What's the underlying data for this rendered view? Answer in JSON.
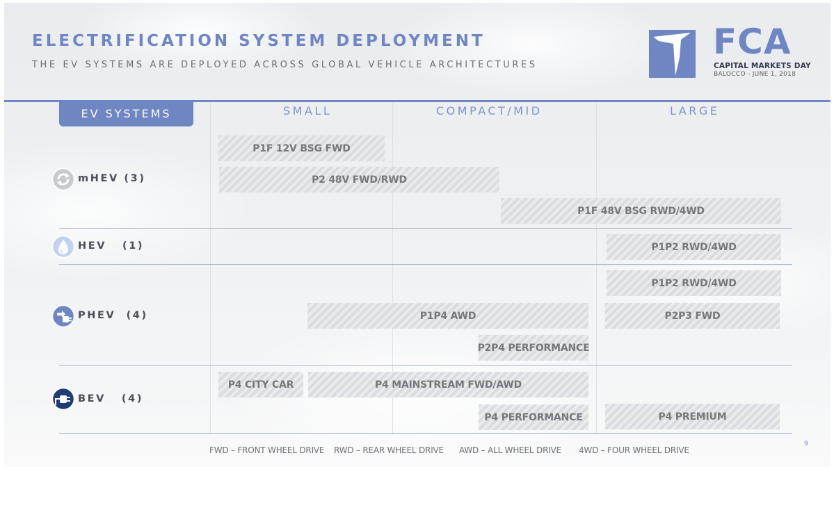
{
  "header": {
    "title": "ELECTRIFICATION SYSTEM DEPLOYMENT",
    "subtitle": "THE EV SYSTEMS ARE DEPLOYED ACROSS GLOBAL VEHICLE ARCHITECTURES"
  },
  "logo": {
    "wordmark": "FCA",
    "event": "CAPITAL MARKETS DAY",
    "location_date": "BALOCCO - JUNE 1, 2018"
  },
  "table": {
    "row_header": "EV SYSTEMS",
    "columns": [
      "SMALL",
      "COMPACT/MID",
      "LARGE"
    ],
    "rows": [
      {
        "label": "mHEV (3)",
        "icon": "recycle-icon"
      },
      {
        "label": "HEV   (1)",
        "icon": "drop-icon"
      },
      {
        "label": "PHEV  (4)",
        "icon": "plug-icon"
      },
      {
        "label": "BEV   (4)",
        "icon": "electric-plug-icon"
      }
    ],
    "bars": [
      "P1F 12V BSG FWD",
      "P2 48V FWD/RWD",
      "P1F 48V BSG RWD/4WD",
      "P1P2 RWD/4WD",
      "P1P2 RWD/4WD",
      "P1P4 AWD",
      "P2P3 FWD",
      "P2P4 PERFORMANCE",
      "P4 CITY CAR",
      "P4 MAINSTREAM FWD/AWD",
      "P4 PERFORMANCE",
      "P4 PREMIUM"
    ]
  },
  "legend": [
    "FWD – FRONT WHEEL DRIVE",
    "RWD – REAR WHEEL DRIVE",
    "AWD – ALL WHEEL DRIVE",
    "4WD – FOUR WHEEL DRIVE"
  ],
  "page_number": "9",
  "colors": {
    "accent": "#6f86c2",
    "bar_text": "#75787e",
    "label": "#4a4f59"
  }
}
